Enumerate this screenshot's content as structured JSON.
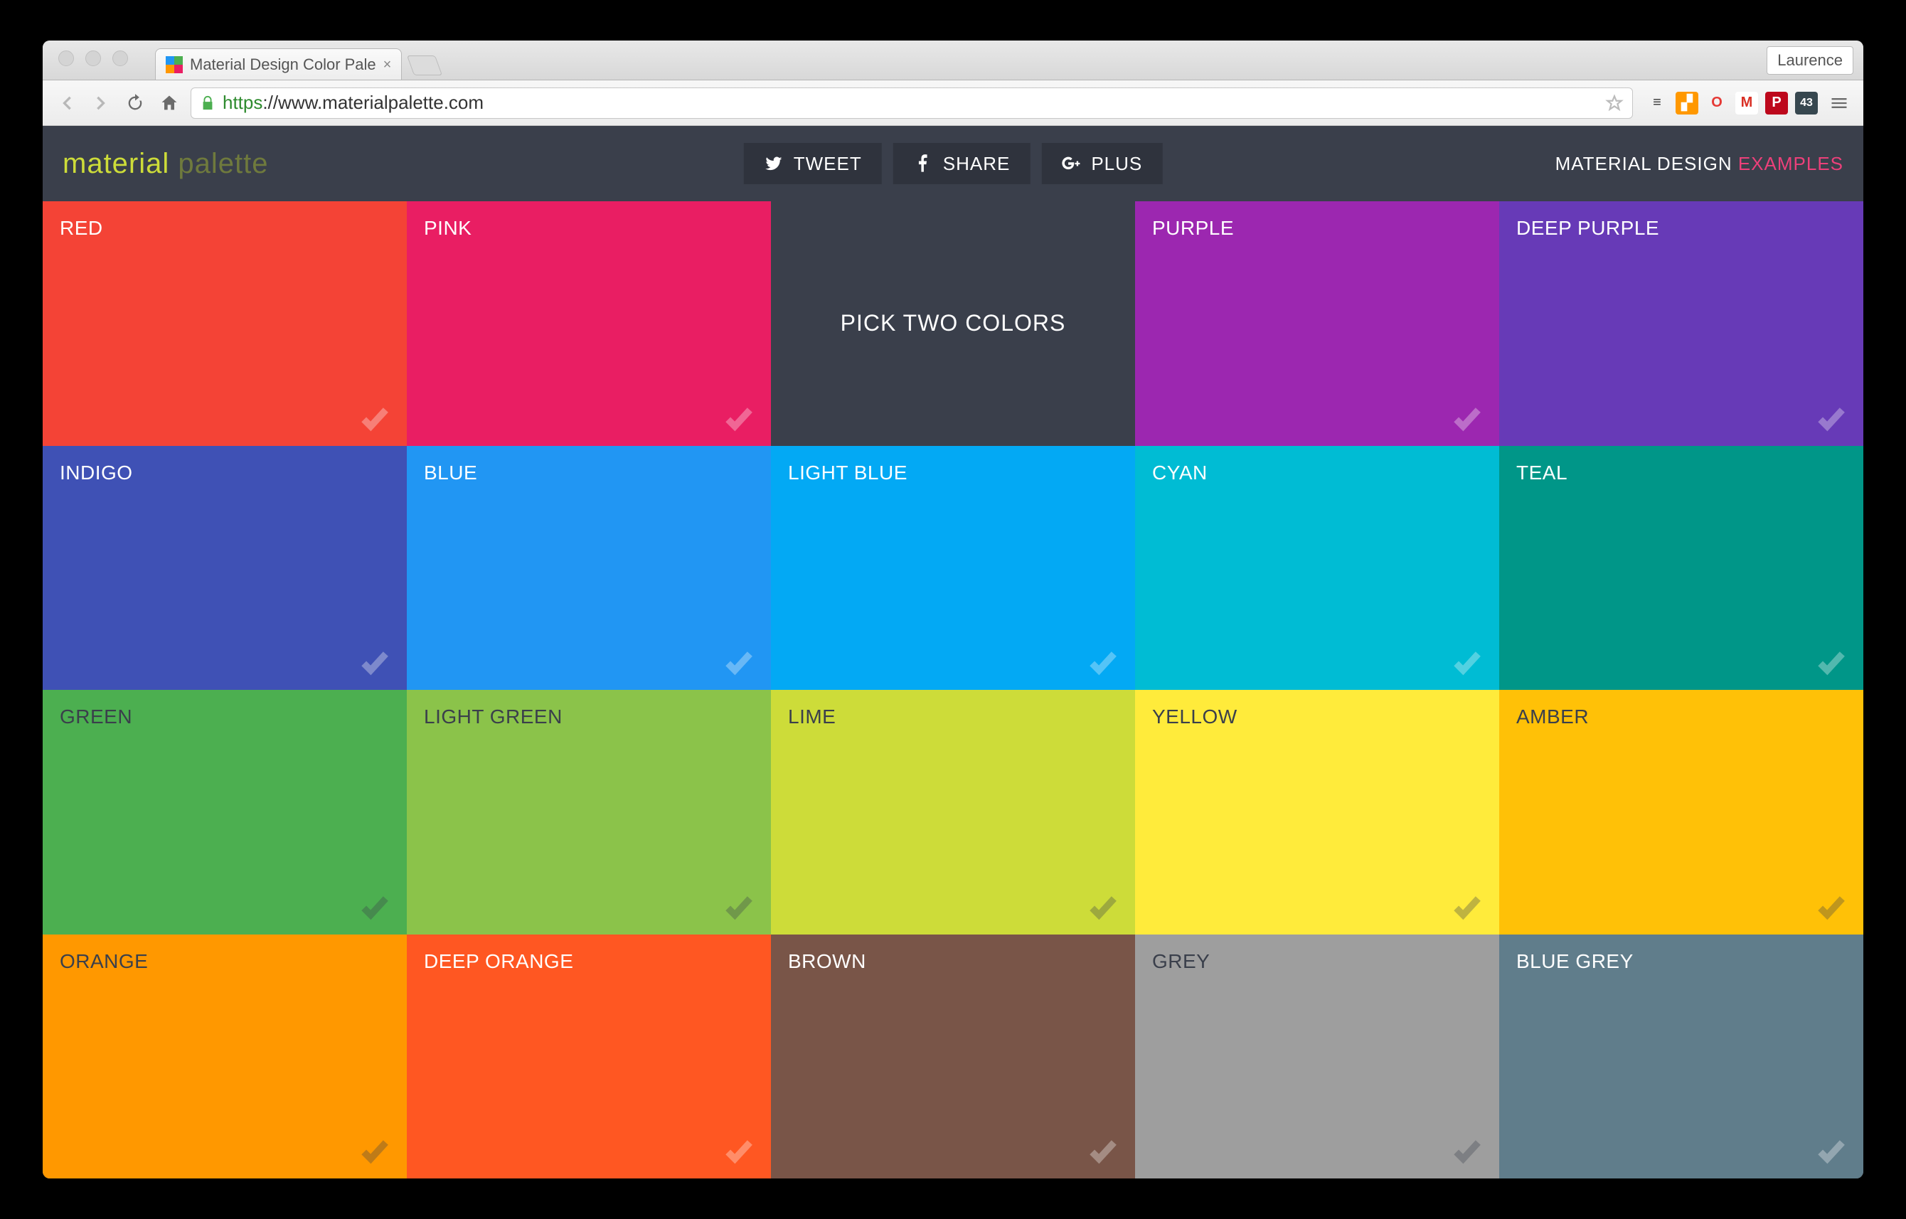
{
  "browser": {
    "tab_title": "Material Design Color Pale",
    "profile_name": "Laurence",
    "url_scheme": "https",
    "url_rest": "://www.materialpalette.com",
    "favicon_colors": [
      "#2196f3",
      "#4caf50",
      "#ff9800",
      "#e91e63"
    ],
    "extensions": [
      {
        "name": "buffer",
        "glyph": "≡",
        "bg": "transparent",
        "fg": "#333"
      },
      {
        "name": "analytics",
        "glyph": "▞",
        "bg": "#ff9800",
        "fg": "#fff"
      },
      {
        "name": "opera",
        "glyph": "O",
        "bg": "transparent",
        "fg": "#e53935"
      },
      {
        "name": "gmail",
        "glyph": "M",
        "bg": "#fff",
        "fg": "#d93025"
      },
      {
        "name": "pinterest",
        "glyph": "P",
        "bg": "#bd081c",
        "fg": "#fff"
      },
      {
        "name": "counter",
        "glyph": "43",
        "bg": "#37474f",
        "fg": "#fff"
      }
    ]
  },
  "header": {
    "logo_word1": "material",
    "logo_word2": "palette",
    "share": {
      "tweet": "TWEET",
      "share": "SHARE",
      "plus": "PLUS"
    },
    "link_text1": "MATERIAL DESIGN ",
    "link_text2": "EXAMPLES"
  },
  "picker_text": "PICK TWO COLORS",
  "swatches": [
    {
      "label": "RED",
      "bg": "#f44336",
      "fg": "#ffffff"
    },
    {
      "label": "PINK",
      "bg": "#e91e63",
      "fg": "#ffffff"
    },
    {
      "label": "__picker__",
      "bg": "#3a3f4b",
      "fg": "#ffffff"
    },
    {
      "label": "PURPLE",
      "bg": "#9c27b0",
      "fg": "#ffffff"
    },
    {
      "label": "DEEP PURPLE",
      "bg": "#673ab7",
      "fg": "#ffffff"
    },
    {
      "label": "INDIGO",
      "bg": "#3f51b5",
      "fg": "#ffffff"
    },
    {
      "label": "BLUE",
      "bg": "#2196f3",
      "fg": "#ffffff"
    },
    {
      "label": "LIGHT BLUE",
      "bg": "#03a9f4",
      "fg": "#ffffff"
    },
    {
      "label": "CYAN",
      "bg": "#00bcd4",
      "fg": "#ffffff"
    },
    {
      "label": "TEAL",
      "bg": "#009688",
      "fg": "#ffffff"
    },
    {
      "label": "GREEN",
      "bg": "#4caf50",
      "fg": "#3a3f4b"
    },
    {
      "label": "LIGHT GREEN",
      "bg": "#8bc34a",
      "fg": "#3a3f4b"
    },
    {
      "label": "LIME",
      "bg": "#cddc39",
      "fg": "#3a3f4b"
    },
    {
      "label": "YELLOW",
      "bg": "#ffeb3b",
      "fg": "#3a3f4b"
    },
    {
      "label": "AMBER",
      "bg": "#ffc107",
      "fg": "#3a3f4b"
    },
    {
      "label": "ORANGE",
      "bg": "#ff9800",
      "fg": "#3a3f4b"
    },
    {
      "label": "DEEP ORANGE",
      "bg": "#ff5722",
      "fg": "#ffffff"
    },
    {
      "label": "BROWN",
      "bg": "#795548",
      "fg": "#ffffff"
    },
    {
      "label": "GREY",
      "bg": "#9e9e9e",
      "fg": "#3a3f4b"
    },
    {
      "label": "BLUE GREY",
      "bg": "#607d8b",
      "fg": "#ffffff"
    }
  ]
}
